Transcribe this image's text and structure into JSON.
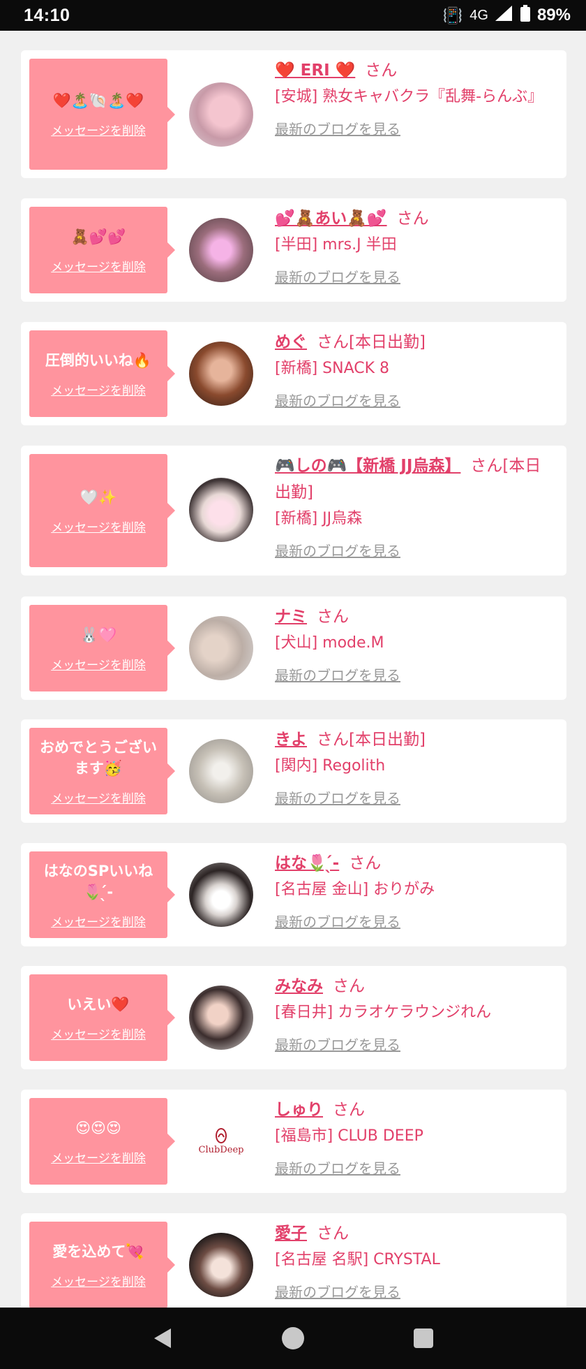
{
  "status": {
    "time": "14:10",
    "network": "4G",
    "battery": "89%"
  },
  "common": {
    "delete_label": "メッセージを削除",
    "blog_label": "最新のブログを見る",
    "san": "さん"
  },
  "items": [
    {
      "message": "❤️🏝️🐚🏝️❤️",
      "name": "❤️ ERI ❤️",
      "suffix": "さん",
      "shop": "[安城] 熟女キャバクラ『乱舞-らんぶ』"
    },
    {
      "message": "🧸💕💕",
      "name": "💕🧸あい🧸💕",
      "suffix": "さん",
      "shop": "[半田] mrs.J 半田"
    },
    {
      "message": "圧倒的いいね🔥",
      "name": "めぐ",
      "suffix": "さん[本日出勤]",
      "shop": "[新橋] SNACK 8"
    },
    {
      "message": "🤍✨",
      "name": "🎮しの🎮【新橋 JJ烏森】",
      "suffix": "さん[本日出勤]",
      "shop": "[新橋] JJ烏森"
    },
    {
      "message": "🐰🩷",
      "name": "ナミ",
      "suffix": "さん",
      "shop": "[犬山] mode.M"
    },
    {
      "message": "おめでとうございます🥳",
      "name": "きよ",
      "suffix": "さん[本日出勤]",
      "shop": "[関内] Regolith"
    },
    {
      "message": "はなのSPいいね🌷 ̖́-",
      "name": "はな🌷 ̖́-",
      "suffix": "さん",
      "shop": "[名古屋 金山] おりがみ"
    },
    {
      "message": "いえい❤️",
      "name": "みなみ",
      "suffix": "さん",
      "shop": "[春日井] カラオケラウンジれん"
    },
    {
      "message": "😍😍😍",
      "name": "しゅり",
      "suffix": "さん",
      "shop": "[福島市] CLUB DEEP",
      "logo_text": "ClubDeep"
    },
    {
      "message": "愛を込めて💘",
      "name": "愛子",
      "suffix": "さん",
      "shop": "[名古屋 名駅] CRYSTAL"
    }
  ]
}
